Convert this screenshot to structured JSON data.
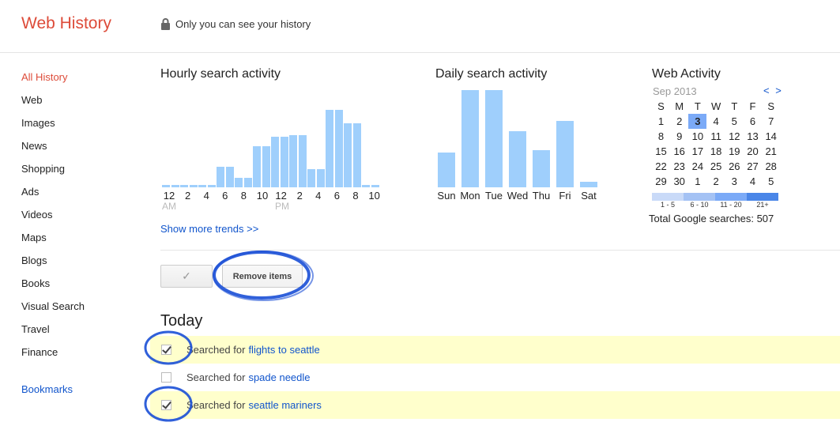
{
  "header": {
    "title": "Web History",
    "privacy_text": "Only you can see your history"
  },
  "sidebar": {
    "items": [
      {
        "label": "All History",
        "active": true
      },
      {
        "label": "Web"
      },
      {
        "label": "Images"
      },
      {
        "label": "News"
      },
      {
        "label": "Shopping"
      },
      {
        "label": "Ads"
      },
      {
        "label": "Videos"
      },
      {
        "label": "Maps"
      },
      {
        "label": "Blogs"
      },
      {
        "label": "Books"
      },
      {
        "label": "Visual Search"
      },
      {
        "label": "Travel"
      },
      {
        "label": "Finance"
      }
    ],
    "bookmarks_label": "Bookmarks"
  },
  "hourly": {
    "title": "Hourly search activity",
    "am_label": "AM",
    "pm_label": "PM",
    "show_more": "Show more trends >>"
  },
  "daily": {
    "title": "Daily search activity"
  },
  "chart_data": [
    {
      "type": "bar",
      "title": "Hourly search activity",
      "categories": [
        "12",
        "1",
        "2",
        "3",
        "4",
        "5",
        "6",
        "7",
        "8",
        "9",
        "10",
        "11",
        "12",
        "1",
        "2",
        "3",
        "4",
        "5",
        "6",
        "7",
        "8",
        "9",
        "10",
        "11"
      ],
      "tick_labels": [
        "12",
        "2",
        "4",
        "6",
        "8",
        "10",
        "12",
        "2",
        "4",
        "6",
        "8",
        "10"
      ],
      "values": [
        1,
        1,
        1,
        1,
        1,
        1,
        9,
        9,
        4,
        4,
        18,
        18,
        22,
        22,
        23,
        23,
        8,
        8,
        34,
        34,
        28,
        28,
        1,
        1
      ],
      "ylim": [
        0,
        36
      ]
    },
    {
      "type": "bar",
      "title": "Daily search activity",
      "categories": [
        "Sun",
        "Mon",
        "Tue",
        "Wed",
        "Thu",
        "Fri",
        "Sat"
      ],
      "values": [
        18,
        50,
        50,
        29,
        19,
        34,
        3
      ],
      "ylim": [
        0,
        50
      ]
    }
  ],
  "calendar": {
    "title": "Web Activity",
    "month": "Sep 2013",
    "nav": "< >",
    "weekdays": [
      "S",
      "M",
      "T",
      "W",
      "T",
      "F",
      "S"
    ],
    "weeks": [
      [
        "1",
        "2",
        "3",
        "4",
        "5",
        "6",
        "7"
      ],
      [
        "8",
        "9",
        "10",
        "11",
        "12",
        "13",
        "14"
      ],
      [
        "15",
        "16",
        "17",
        "18",
        "19",
        "20",
        "21"
      ],
      [
        "22",
        "23",
        "24",
        "25",
        "26",
        "27",
        "28"
      ],
      [
        "29",
        "30",
        "1",
        "2",
        "3",
        "4",
        "5"
      ]
    ],
    "selected_day": "3",
    "legend": [
      "1 - 5",
      "6 - 10",
      "11 - 20",
      "21+"
    ],
    "legend_colors": [
      "#c9daf8",
      "#a4c2f4",
      "#7baaf7",
      "#4a86e8"
    ],
    "total": "Total Google searches: 507"
  },
  "actions": {
    "select_check": "✓",
    "remove_label": "Remove items"
  },
  "today": {
    "heading": "Today",
    "prefix": "Searched for",
    "items": [
      {
        "query": "flights to seattle",
        "checked": true
      },
      {
        "query": "spade needle",
        "checked": false
      },
      {
        "query": "seattle mariners",
        "checked": true
      }
    ]
  },
  "colors": {
    "brand": "#dd4b39",
    "link": "#1155cc",
    "bar": "#9fcffc",
    "highlight": "#ffffcc",
    "annotation": "#1a4fd6"
  }
}
